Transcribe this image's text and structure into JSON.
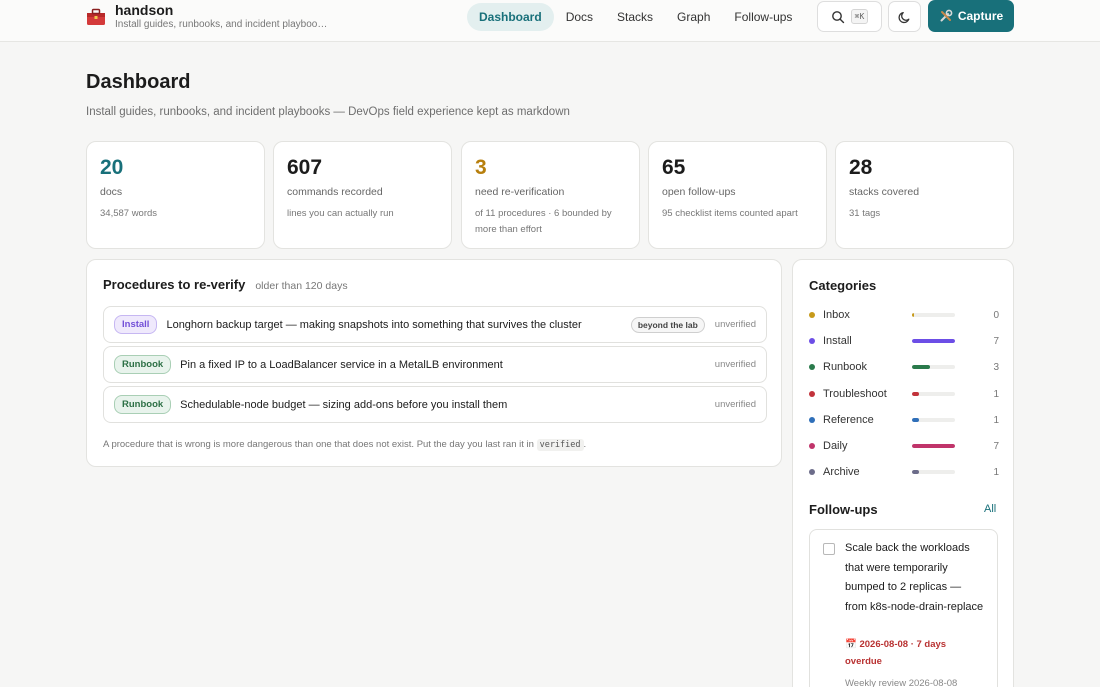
{
  "app": {
    "name": "handson",
    "tagline": "Install guides, runbooks, and incident playbooks — DevOps field experience kept as markdown"
  },
  "nav": {
    "tabs": [
      {
        "label": "Dashboard",
        "active": true
      },
      {
        "label": "Docs",
        "active": false
      },
      {
        "label": "Stacks",
        "active": false
      },
      {
        "label": "Graph",
        "active": false
      },
      {
        "label": "Follow-ups",
        "active": false
      }
    ],
    "search_shortcut": "⌘K",
    "capture_label": "Capture"
  },
  "page": {
    "title": "Dashboard",
    "subtitle": "Install guides, runbooks, and incident playbooks — DevOps field experience kept as markdown"
  },
  "stats": [
    {
      "value": "20",
      "label": "docs",
      "note": "34,587 words",
      "color": "#18707a"
    },
    {
      "value": "607",
      "label": "commands recorded",
      "note": "lines you can actually run",
      "color": "#1c1c1c"
    },
    {
      "value": "3",
      "label": "need re-verification",
      "note": "of 11 procedures · 6 bounded by more than effort",
      "color": "#b77f0d"
    },
    {
      "value": "65",
      "label": "open follow-ups",
      "note": "95 checklist items counted apart",
      "color": "#1c1c1c"
    },
    {
      "value": "28",
      "label": "stacks covered",
      "note": "31 tags",
      "color": "#1c1c1c"
    }
  ],
  "procedures": {
    "title": "Procedures to re-verify",
    "hint": "older than 120 days",
    "items": [
      {
        "type": "Install",
        "title": "Longhorn backup target — making snapshots into something that survives the cluster",
        "tag": "beyond the lab",
        "status": "unverified"
      },
      {
        "type": "Runbook",
        "title": "Pin a fixed IP to a LoadBalancer service in a MetalLB environment",
        "tag": "",
        "status": "unverified"
      },
      {
        "type": "Runbook",
        "title": "Schedulable-node budget — sizing add-ons before you install them",
        "tag": "",
        "status": "unverified"
      }
    ],
    "footer": "A procedure that is wrong is more dangerous than one that does not exist. Put the day you last ran it in",
    "footer_code": "verified",
    "footer_end": "."
  },
  "categories": {
    "title": "Categories",
    "max": 7,
    "items": [
      {
        "name": "Inbox",
        "count": 0,
        "color": "#c79a1a"
      },
      {
        "name": "Install",
        "count": 7,
        "color": "#6c4ee6"
      },
      {
        "name": "Runbook",
        "count": 3,
        "color": "#2a7a4b"
      },
      {
        "name": "Troubleshoot",
        "count": 1,
        "color": "#c2333b"
      },
      {
        "name": "Reference",
        "count": 1,
        "color": "#2f6fb9"
      },
      {
        "name": "Daily",
        "count": 7,
        "color": "#c0346a"
      },
      {
        "name": "Archive",
        "count": 1,
        "color": "#6c6c8a"
      }
    ]
  },
  "followups": {
    "title": "Follow-ups",
    "all_label": "All",
    "item": {
      "text": "Scale back the workloads that were temporarily bumped to 2 replicas — from k8s-node-drain-replace",
      "due": "📅 2026-08-08 · 7 days overdue",
      "review": "Weekly review 2026-08-08"
    }
  }
}
